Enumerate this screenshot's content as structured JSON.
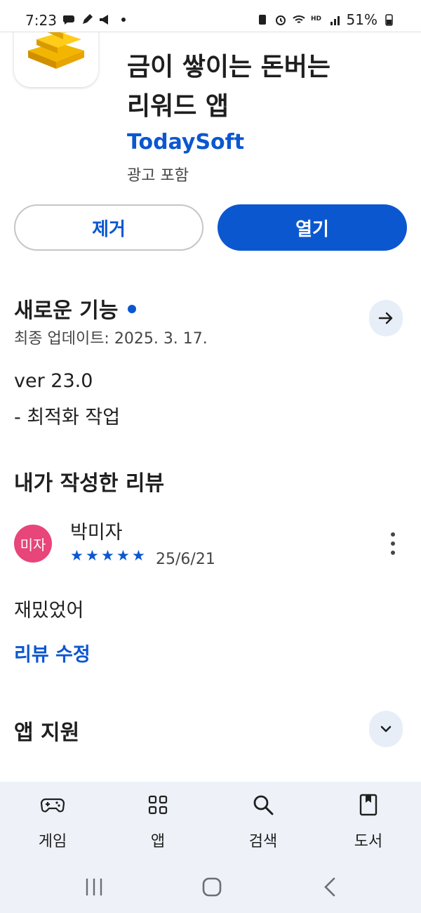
{
  "status_bar": {
    "time": "7:23",
    "battery": "51%"
  },
  "app": {
    "title_lines": [
      "금이 쌓이는 돈버는",
      "리워드 앱"
    ],
    "developer": "TodaySoft",
    "ad_note": "광고 포함"
  },
  "actions": {
    "remove_label": "제거",
    "open_label": "열기"
  },
  "whats_new": {
    "title": "새로운 기능",
    "last_update": "최종 업데이트: 2025. 3. 17.",
    "version": "ver 23.0",
    "notes": "- 최적화 작업"
  },
  "my_review": {
    "title": "내가 작성한 리뷰",
    "avatar_text": "미자",
    "reviewer": "박미자",
    "rating": 5,
    "date": "25/6/21",
    "text": "재밌었어",
    "edit_label": "리뷰 수정"
  },
  "app_support": {
    "title": "앱 지원"
  },
  "bottom_nav": {
    "items": [
      {
        "label": "게임",
        "icon": "gamepad-icon"
      },
      {
        "label": "앱",
        "icon": "apps-grid-icon"
      },
      {
        "label": "검색",
        "icon": "search-icon"
      },
      {
        "label": "도서",
        "icon": "book-icon"
      }
    ]
  },
  "colors": {
    "accent": "#0b57d0",
    "avatar": "#e8457a",
    "nav_bg": "#eef2f8"
  }
}
